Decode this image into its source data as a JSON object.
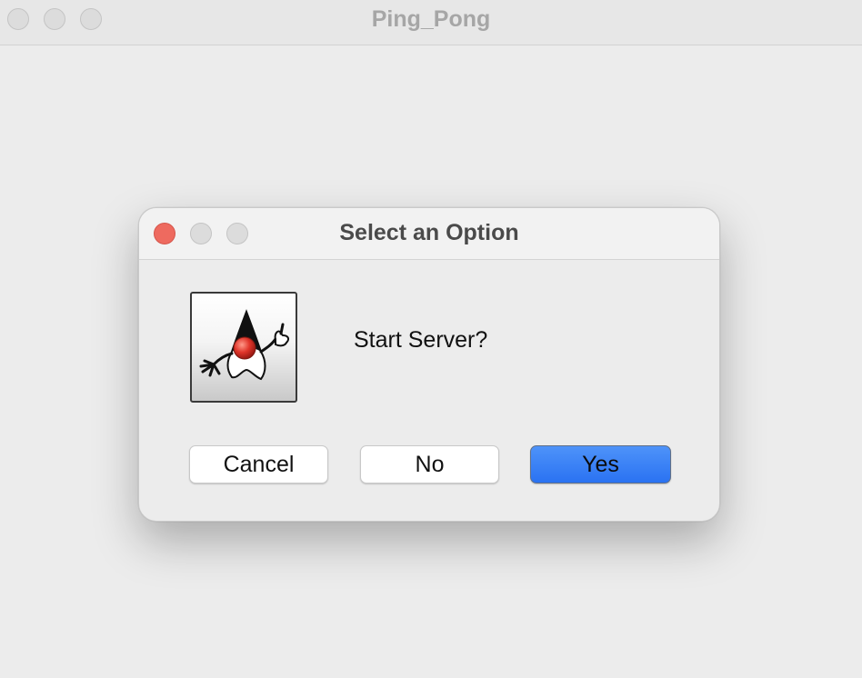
{
  "main_window": {
    "title": "Ping_Pong"
  },
  "dialog": {
    "title": "Select an Option",
    "message": "Start Server?",
    "icon": "java-duke-icon",
    "buttons": {
      "cancel": "Cancel",
      "no": "No",
      "yes": "Yes"
    }
  },
  "colors": {
    "window_background": "#ececec",
    "close_button": "#ee6a5f",
    "default_button": "#2f7bf5"
  }
}
